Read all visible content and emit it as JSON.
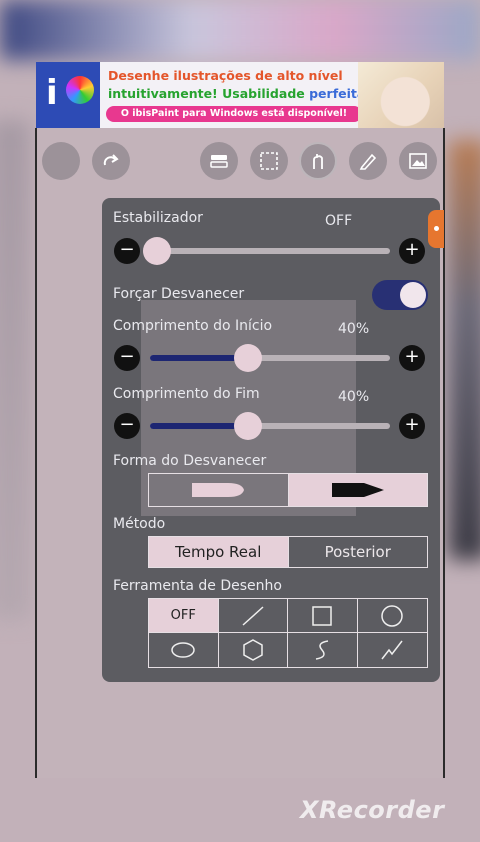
{
  "ad": {
    "line1": "Desenhe ilustrações de alto nível",
    "line2_a": "intuitivamente!",
    "line2_b": "Usabilidade",
    "line2_c": "perfeita!",
    "pill": "O ibisPaint para Windows está disponível!",
    "logo_letter": "i"
  },
  "toolbar": {
    "icons": [
      "undo-icon",
      "redo-icon",
      "layer-icon",
      "selection-icon",
      "stabilizer-icon",
      "pen-icon",
      "gallery-icon"
    ]
  },
  "stabilizer": {
    "label": "Estabilizador",
    "value": "OFF",
    "level": 0,
    "minus": "−",
    "plus": "+"
  },
  "force_fade": {
    "label": "Forçar Desvanecer",
    "enabled": true
  },
  "start_length": {
    "label": "Comprimento do Início",
    "value": "40%",
    "level": 0.4
  },
  "end_length": {
    "label": "Comprimento do Fim",
    "value": "40%",
    "level": 0.4
  },
  "fade_shape": {
    "label": "Forma do Desvanecer"
  },
  "method": {
    "label": "Método",
    "options": [
      "Tempo Real",
      "Posterior"
    ],
    "selected": 0
  },
  "drawing_tool": {
    "label": "Ferramenta de Desenho",
    "off": "OFF"
  },
  "watermark": "XRecorder",
  "colors": {
    "accent": "#1d2672",
    "selected": "#e6d0d9",
    "panel": "#5c5c61"
  }
}
